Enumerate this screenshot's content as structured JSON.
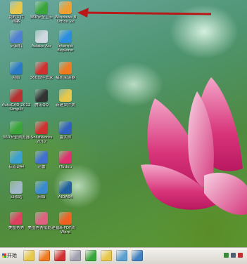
{
  "desktop": {
    "icons": [
      {
        "label": "我的文件\n档案",
        "icon": "folder-icon",
        "color": "#e8c84a"
      },
      {
        "label": "360安全卫士",
        "icon": "shield-icon",
        "color": "#3aa63a"
      },
      {
        "label": "Windows 8\nOffice 2k",
        "icon": "office-icon",
        "color": "#f0a030"
      },
      {
        "label": "计算机",
        "icon": "computer-icon",
        "color": "#4f7fd0"
      },
      {
        "label": "Adobe Acr",
        "icon": "recycle-icon",
        "color": "#cfd8e0"
      },
      {
        "label": "Internet\nExplorer",
        "icon": "ie-icon",
        "color": "#2a8ee0"
      },
      {
        "label": "网络",
        "icon": "network-icon",
        "color": "#2a7ac8"
      },
      {
        "label": "360软件管家",
        "icon": "software-manager-icon",
        "color": "#d03030"
      },
      {
        "label": "福昕阅读器",
        "icon": "pdf-reader-icon",
        "color": "#f07a20"
      },
      {
        "label": "AutoCAD 2012\nSimplif",
        "icon": "autocad-icon",
        "color": "#b83030"
      },
      {
        "label": "腾讯QQ",
        "icon": "qq-icon",
        "color": "#333333"
      },
      {
        "label": "新建文件夹",
        "icon": "new-folder-icon",
        "color": "#e8c84a"
      },
      {
        "label": "360安全浏览器",
        "icon": "browser-icon",
        "color": "#3aa63a"
      },
      {
        "label": "SolidWorks\n2012",
        "icon": "solidworks-icon",
        "color": "#d03030"
      },
      {
        "label": "鲁大师",
        "icon": "ludashi-icon",
        "color": "#3060c0"
      },
      {
        "label": "有道词典",
        "icon": "dictionary-icon",
        "color": "#3aa0d0"
      },
      {
        "label": "迅雷",
        "icon": "thunder-icon",
        "color": "#4070d0"
      },
      {
        "label": "iTudou",
        "icon": "itudou-icon",
        "color": "#e03070"
      },
      {
        "label": "回收站",
        "icon": "recycle-bin-icon",
        "color": "#a0b8c8"
      },
      {
        "label": "网络",
        "icon": "network-globe-icon",
        "color": "#3a8ad0"
      },
      {
        "label": "AIDA64",
        "icon": "aida-icon",
        "color": "#2060a0"
      },
      {
        "label": "美图秀秀",
        "icon": "meitu-icon",
        "color": "#e04060"
      },
      {
        "label": "美图秀秀批处理",
        "icon": "meitu-batch-icon",
        "color": "#e06080"
      },
      {
        "label": "福昕PDF转\nWord",
        "icon": "pdf-to-word-icon",
        "color": "#f06020"
      }
    ]
  },
  "annotation": {
    "color": "#b81818"
  },
  "taskbar": {
    "start_label": "开始",
    "items": [
      {
        "icon": "folder-icon",
        "color": "#e8c84a"
      },
      {
        "icon": "foxit-icon",
        "color": "#f07a20"
      },
      {
        "icon": "pdf-icon",
        "color": "#d03030"
      },
      {
        "icon": "tools-icon",
        "color": "#a0a0b0"
      },
      {
        "icon": "360-icon",
        "color": "#3aa63a"
      },
      {
        "icon": "explorer-icon",
        "color": "#e8c84a"
      },
      {
        "icon": "image-icon",
        "color": "#5aa0d0"
      },
      {
        "icon": "window-icon",
        "color": "#4080c0"
      }
    ],
    "tray": [
      {
        "icon": "network-tray-icon",
        "color": "#3a8a3a"
      },
      {
        "icon": "volume-tray-icon",
        "color": "#506070"
      },
      {
        "icon": "security-tray-icon",
        "color": "#c03030"
      }
    ]
  }
}
